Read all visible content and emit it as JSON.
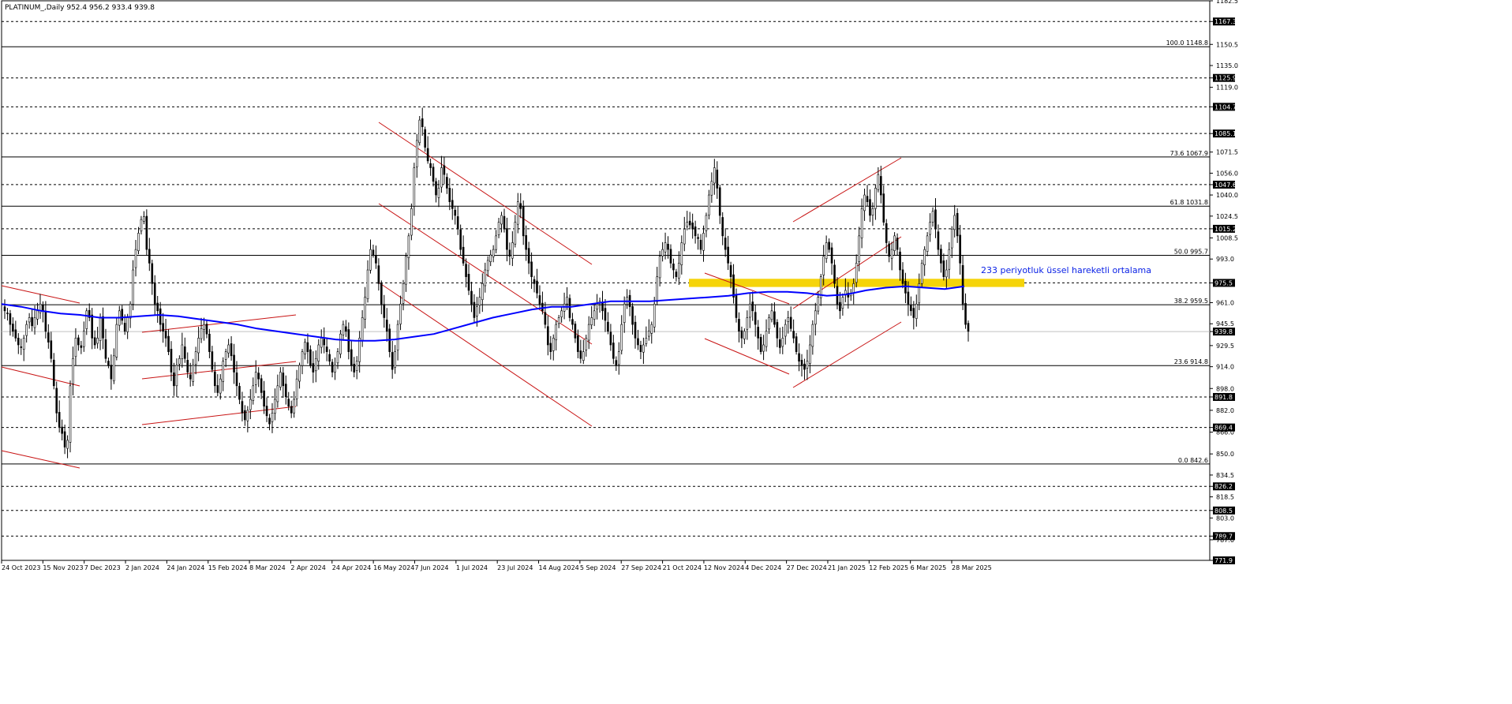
{
  "chart_data": {
    "type": "candlestick",
    "symbol_header": "PLATINUM_,Daily  952.4 956.2 933.4 939.8",
    "ohlc_last": {
      "open": 952.4,
      "high": 956.2,
      "low": 933.4,
      "close": 939.8
    },
    "ylim": [
      771.9,
      1182.5
    ],
    "y_ticks": [
      1182.5,
      1167.3,
      1150.5,
      1135.0,
      1125.9,
      1119.0,
      1104.7,
      1085.1,
      1071.5,
      1056.0,
      1047.6,
      1040.0,
      1024.5,
      1015.2,
      1008.5,
      993.0,
      975.5,
      961.0,
      945.5,
      939.8,
      929.5,
      914.0,
      898.0,
      891.8,
      882.0,
      869.4,
      866.0,
      850.0,
      834.5,
      826.2,
      818.5,
      808.5,
      803.0,
      789.7,
      787.0,
      771.9
    ],
    "y_tick_labels": [
      "1182.5",
      "1167.3",
      "1150.5",
      "1135.0",
      "1125.9",
      "1119.0",
      "1104.7",
      "1085.1",
      "1071.5",
      "1056.0",
      "1047.6",
      "1040.0",
      "1024.5",
      "1015.2",
      "1008.5",
      "993.0",
      "975.5",
      "961.0",
      "945.5",
      "939.8",
      "929.5",
      "914.0",
      "898.0",
      "891.8",
      "882.0",
      "869.4",
      "866.0",
      "850.0",
      "834.5",
      "826.2",
      "818.5",
      "808.5",
      "803.0",
      "789.7",
      "787.0",
      "771.9"
    ],
    "highlighted_levels": [
      1167.3,
      1125.9,
      1104.7,
      1085.1,
      1047.6,
      1015.2,
      975.5,
      939.8,
      891.8,
      869.4,
      826.2,
      808.5,
      789.7,
      771.9
    ],
    "x_tick_labels": [
      "24 Oct 2023",
      "15 Nov 2023",
      "7 Dec 2023",
      "2 Jan 2024",
      "24 Jan 2024",
      "15 Feb 2024",
      "8 Mar 2024",
      "2 Apr 2024",
      "24 Apr 2024",
      "16 May 2024",
      "7 Jun 2024",
      "1 Jul 2024",
      "23 Jul 2024",
      "14 Aug 2024",
      "5 Sep 2024",
      "27 Sep 2024",
      "21 Oct 2024",
      "12 Nov 2024",
      "4 Dec 2024",
      "27 Dec 2024",
      "21 Jan 2025",
      "12 Feb 2025",
      "6 Mar 2025",
      "28 Mar 2025"
    ],
    "horizontal_dotted_levels": [
      1167.3,
      1125.9,
      1104.7,
      1085.1,
      1047.6,
      1015.2,
      975.5,
      891.8,
      869.4,
      826.2,
      808.5,
      789.7
    ],
    "fibonacci_levels": [
      {
        "label": "100.0 1148.8",
        "value": 1148.8
      },
      {
        "label": "73.6 1067.9",
        "value": 1067.9
      },
      {
        "label": "61.8 1031.8",
        "value": 1031.8
      },
      {
        "label": "50.0 995.7",
        "value": 995.7
      },
      {
        "label": "38.2 959.5",
        "value": 959.5
      },
      {
        "label": "23.6 914.8",
        "value": 914.8
      },
      {
        "label": "0.0 842.6",
        "value": 842.6
      }
    ],
    "support_zone": {
      "from": 972.5,
      "to": 978.5,
      "color": "#f5d40a"
    },
    "annotation": "233 periyotluk üssel hareketli ortalama",
    "ema": {
      "name": "233 periyotluk üssel hareketli ortalama",
      "color": "#0000ff",
      "values": [
        960,
        958,
        955,
        953,
        952,
        950,
        950,
        951,
        952,
        951,
        949,
        947,
        945,
        942,
        940,
        938,
        936,
        934,
        933,
        933,
        934,
        936,
        938,
        942,
        946,
        950,
        953,
        956,
        958,
        958,
        960,
        962,
        962,
        962,
        963,
        964,
        965,
        966,
        968,
        969,
        969,
        968,
        966,
        967,
        970,
        972,
        973,
        972,
        971,
        973
      ]
    },
    "closes": [
      955,
      953,
      945,
      940,
      935,
      930,
      928,
      935,
      945,
      950,
      944,
      950,
      955,
      960,
      955,
      940,
      932,
      920,
      900,
      880,
      870,
      865,
      855,
      860,
      900,
      920,
      935,
      930,
      928,
      940,
      955,
      950,
      935,
      930,
      935,
      950,
      935,
      920,
      915,
      905,
      922,
      945,
      955,
      948,
      940,
      950,
      960,
      985,
      1000,
      1012,
      1022,
      1024,
      1000,
      990,
      975,
      960,
      955,
      945,
      940,
      935,
      925,
      910,
      900,
      915,
      920,
      930,
      920,
      910,
      905,
      915,
      925,
      935,
      942,
      945,
      938,
      925,
      912,
      900,
      895,
      905,
      918,
      925,
      930,
      922,
      910,
      900,
      890,
      880,
      875,
      882,
      890,
      900,
      910,
      905,
      895,
      885,
      878,
      872,
      880,
      890,
      900,
      910,
      900,
      892,
      885,
      880,
      890,
      905,
      915,
      925,
      932,
      925,
      915,
      910,
      920,
      930,
      935,
      930,
      925,
      918,
      910,
      915,
      925,
      938,
      945,
      940,
      925,
      915,
      910,
      918,
      935,
      950,
      965,
      985,
      1000,
      996,
      990,
      975,
      960,
      950,
      940,
      925,
      912,
      925,
      945,
      960,
      975,
      995,
      1010,
      1030,
      1060,
      1080,
      1095,
      1090,
      1075,
      1065,
      1060,
      1050,
      1040,
      1045,
      1060,
      1055,
      1045,
      1035,
      1030,
      1025,
      1015,
      1000,
      990,
      980,
      970,
      960,
      950,
      958,
      965,
      975,
      985,
      992,
      996,
      1000,
      1010,
      1020,
      1025,
      1015,
      1000,
      995,
      1005,
      1020,
      1035,
      1030,
      1010,
      1000,
      990,
      980,
      975,
      968,
      960,
      955,
      945,
      930,
      925,
      935,
      945,
      950,
      955,
      960,
      965,
      950,
      945,
      935,
      925,
      920,
      925,
      935,
      945,
      950,
      955,
      960,
      962,
      955,
      948,
      940,
      930,
      920,
      915,
      925,
      945,
      960,
      965,
      958,
      945,
      935,
      930,
      925,
      930,
      935,
      940,
      945,
      960,
      980,
      995,
      1000,
      1005,
      1000,
      990,
      985,
      980,
      990,
      1005,
      1015,
      1020,
      1018,
      1015,
      1010,
      1008,
      1000,
      1012,
      1025,
      1040,
      1050,
      1060,
      1045,
      1025,
      1010,
      1000,
      990,
      980,
      965,
      950,
      940,
      935,
      940,
      950,
      960,
      955,
      945,
      935,
      925,
      930,
      940,
      950,
      955,
      945,
      935,
      928,
      935,
      945,
      950,
      942,
      935,
      925,
      918,
      915,
      912,
      918,
      930,
      945,
      955,
      965,
      980,
      995,
      1005,
      1000,
      990,
      975,
      960,
      955,
      965,
      970,
      965,
      968,
      975,
      990,
      1010,
      1030,
      1040,
      1035,
      1025,
      1030,
      1045,
      1055,
      1040,
      1020,
      1005,
      995,
      1000,
      1010,
      1000,
      985,
      975,
      968,
      960,
      955,
      950,
      960,
      975,
      990,
      1000,
      1010,
      1020,
      1028,
      1015,
      1000,
      990,
      980,
      985,
      1000,
      1015,
      1025,
      1010,
      990,
      960,
      945,
      940
    ]
  }
}
